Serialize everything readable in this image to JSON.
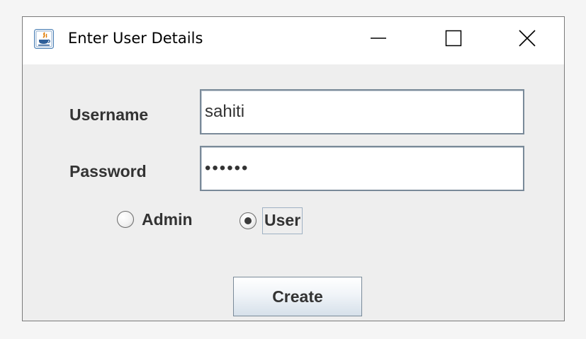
{
  "window": {
    "title": "Enter User Details"
  },
  "form": {
    "username_label": "Username",
    "username_value": "sahiti",
    "password_label": "Password",
    "password_value": "••••••",
    "role_options": [
      {
        "label": "Admin",
        "selected": false
      },
      {
        "label": "User",
        "selected": true
      }
    ],
    "create_label": "Create"
  },
  "icons": {
    "app": "java-cup-icon",
    "minimize": "minimize-icon",
    "maximize": "maximize-icon",
    "close": "close-icon"
  }
}
